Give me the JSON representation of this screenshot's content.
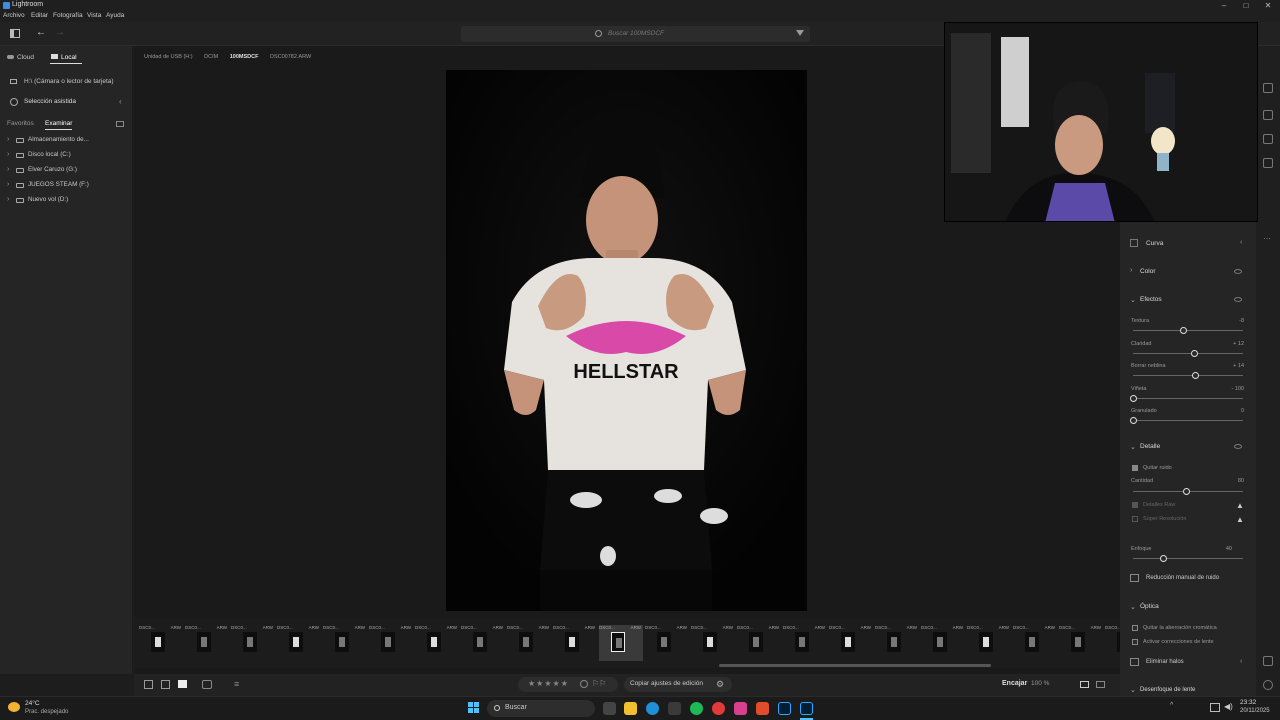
{
  "titlebar": {
    "title": "Lightroom"
  },
  "menubar": {
    "items": [
      "Archivo",
      "Editar",
      "Fotografía",
      "Vista",
      "Ayuda"
    ]
  },
  "toolbar": {
    "search_placeholder": "Buscar 100MSDCF"
  },
  "leftpanel": {
    "tabs": {
      "cloud": "Cloud",
      "local": "Local"
    },
    "source": "H:\\ (Cámara o lector de tarjeta)",
    "assisted": "Selección asistida",
    "subtabs": {
      "favorites": "Favoritos",
      "browse": "Examinar"
    },
    "drives": [
      "Almacenamiento de...",
      "Disco local (C:)",
      "Elver Caruzo (G:)",
      "JUEGOS STEAM (F:)",
      "Nuevo vol (D:)"
    ]
  },
  "breadcrumb": [
    "Unidad de USB (H:)",
    "DCIM",
    "100MSDCF",
    "DSC00782.ARW"
  ],
  "photo": {
    "shirt_brand": "HELLSTAR",
    "colors": {
      "pink": "#d94aa8",
      "shirt": "#e6e3df"
    }
  },
  "filmstrip": {
    "caption_name": "DSC0...",
    "caption_ext": "ARW",
    "count": 22,
    "selected_index": 10
  },
  "bottombar": {
    "copy_label": "Copiar ajustes de edición",
    "fit_label": "Encajar",
    "zoom_label": "100 %"
  },
  "rightpanel": {
    "curve": "Curva",
    "color": "Color",
    "effects": {
      "title": "Efectos",
      "sliders": [
        {
          "label": "Textura",
          "value": "-8",
          "pos": 0.45
        },
        {
          "label": "Claridad",
          "value": "+ 12",
          "pos": 0.55
        },
        {
          "label": "Borrar neblina",
          "value": "+ 14",
          "pos": 0.56
        },
        {
          "label": "Viñeta",
          "value": "- 100",
          "pos": 0.0
        },
        {
          "label": "Granulado",
          "value": "0",
          "pos": 0.0
        }
      ]
    },
    "detail": {
      "title": "Detalle",
      "denoise": "Quitar ruido",
      "amount": {
        "label": "Cantidad",
        "value": "80",
        "pos": 0.48
      },
      "raw_details": "Detalles Raw",
      "super_res": "Súper Resolución",
      "sharpen": {
        "label": "Enfoque",
        "value": "40",
        "pos": 0.27
      },
      "manual_noise": "Reducción manual de ruido"
    },
    "optics": {
      "title": "Óptica",
      "remove_ca": "Quitar la aberración cromática",
      "lens_corrections": "Activar correcciones de lente",
      "remove_halos": "Eliminar halos"
    },
    "lens_blur": "Desenfoque de lente"
  },
  "taskbar": {
    "weather_temp": "24°C",
    "weather_desc": "Prac. despejado",
    "search": "Buscar",
    "time": "23:32",
    "date": "20/11/2025"
  }
}
